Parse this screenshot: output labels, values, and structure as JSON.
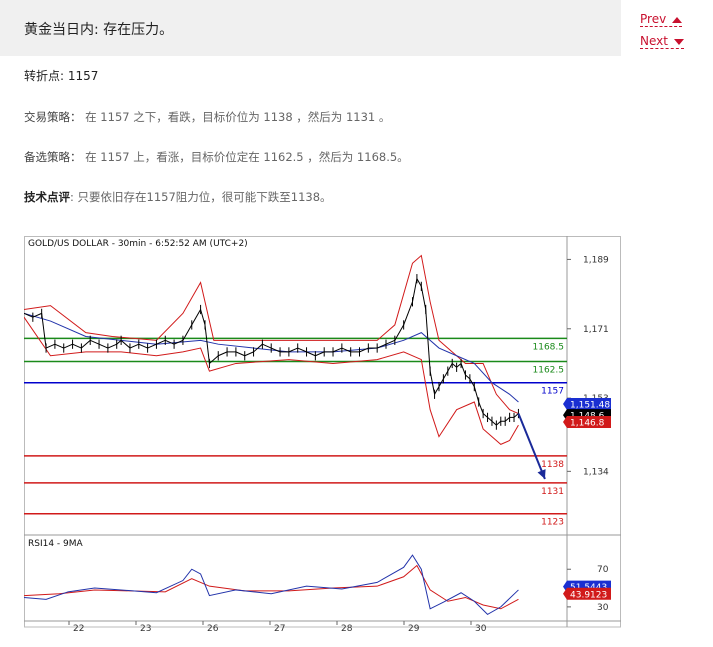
{
  "header": {
    "title": "黄金当日内: 存在压力。"
  },
  "nav": {
    "prev": "Prev",
    "next": "Next"
  },
  "article": {
    "pivot_label": "转折点:",
    "pivot_value": "1157",
    "strategy_label": "交易策略：",
    "strategy_text": "在 1157 之下，看跌，目标价位为 1138 ，然后为 1131 。",
    "alt_label": "备选策略：",
    "alt_text": "在 1157 上，看涨，目标价位定在 1162.5 ，然后为 1168.5。",
    "tech_label": "技术点评",
    "tech_text": ": 只要依旧存在1157阻力位，很可能下跌至1138。"
  },
  "chart": {
    "title": "GOLD/US DOLLAR - 30min - 6:52:52 AM (UTC+2)",
    "rsi_title": "RSI14 - 9MA",
    "colors": {
      "price": "#000000",
      "bollinger": "#d11a1a",
      "ma": "#2233aa",
      "support": "#d11a1a",
      "resistance": "#1a8a1a",
      "pivot": "#0000cc"
    }
  },
  "chart_data": {
    "type": "line",
    "x_ticks": [
      "22",
      "23",
      "26",
      "27",
      "28",
      "29",
      "30"
    ],
    "y_ticks": [
      "1,189",
      "1,171",
      "1,153",
      "1,134"
    ],
    "ylim": [
      1118,
      1193
    ],
    "levels": [
      {
        "label": "1168.5",
        "value": 1168.5,
        "kind": "resistance"
      },
      {
        "label": "1162.5",
        "value": 1162.5,
        "kind": "resistance"
      },
      {
        "label": "1157",
        "value": 1157,
        "kind": "pivot"
      },
      {
        "label": "1138",
        "value": 1138,
        "kind": "support"
      },
      {
        "label": "1131",
        "value": 1131,
        "kind": "support"
      },
      {
        "label": "1123",
        "value": 1123,
        "kind": "support"
      }
    ],
    "price_badges": [
      {
        "label": "1,151.48",
        "value": 1151.48,
        "color": "#1a2fd1"
      },
      {
        "label": "1,148.6",
        "value": 1148.6,
        "color": "#000000"
      },
      {
        "label": "1,146.8",
        "value": 1146.8,
        "color": "#d11a1a"
      }
    ],
    "price": [
      [
        0,
        1175
      ],
      [
        2,
        1174
      ],
      [
        4,
        1175
      ],
      [
        5,
        1166
      ],
      [
        7,
        1167
      ],
      [
        9,
        1166
      ],
      [
        11,
        1167
      ],
      [
        13,
        1166
      ],
      [
        15,
        1168
      ],
      [
        17,
        1167
      ],
      [
        19,
        1166
      ],
      [
        21,
        1167
      ],
      [
        22,
        1168
      ],
      [
        24,
        1166
      ],
      [
        26,
        1167
      ],
      [
        28,
        1166
      ],
      [
        30,
        1167
      ],
      [
        32,
        1168
      ],
      [
        34,
        1167
      ],
      [
        36,
        1168
      ],
      [
        38,
        1172
      ],
      [
        40,
        1176
      ],
      [
        41,
        1172
      ],
      [
        42,
        1162
      ],
      [
        44,
        1164
      ],
      [
        46,
        1165
      ],
      [
        48,
        1165
      ],
      [
        50,
        1164
      ],
      [
        52,
        1165
      ],
      [
        54,
        1167
      ],
      [
        56,
        1166
      ],
      [
        58,
        1165
      ],
      [
        60,
        1165
      ],
      [
        62,
        1166
      ],
      [
        64,
        1165
      ],
      [
        66,
        1164
      ],
      [
        68,
        1165
      ],
      [
        70,
        1165
      ],
      [
        72,
        1166
      ],
      [
        74,
        1165
      ],
      [
        76,
        1165
      ],
      [
        78,
        1166
      ],
      [
        80,
        1166
      ],
      [
        82,
        1167
      ],
      [
        84,
        1168
      ],
      [
        86,
        1172
      ],
      [
        88,
        1178
      ],
      [
        89,
        1184
      ],
      [
        90,
        1182
      ],
      [
        91,
        1176
      ],
      [
        92,
        1160
      ],
      [
        93,
        1154
      ],
      [
        94,
        1156
      ],
      [
        95,
        1158
      ],
      [
        96,
        1160
      ],
      [
        97,
        1162
      ],
      [
        98,
        1161
      ],
      [
        99,
        1162
      ],
      [
        100,
        1159
      ],
      [
        101,
        1158
      ],
      [
        102,
        1156
      ],
      [
        103,
        1152
      ],
      [
        104,
        1149
      ],
      [
        105,
        1148
      ],
      [
        106,
        1147
      ],
      [
        107,
        1146
      ],
      [
        108,
        1147
      ],
      [
        109,
        1147
      ],
      [
        110,
        1148
      ],
      [
        111,
        1148
      ],
      [
        112,
        1149
      ]
    ],
    "ma": [
      [
        0,
        1175
      ],
      [
        6,
        1173
      ],
      [
        14,
        1169
      ],
      [
        22,
        1168
      ],
      [
        30,
        1167
      ],
      [
        40,
        1168
      ],
      [
        44,
        1167
      ],
      [
        52,
        1166
      ],
      [
        60,
        1165
      ],
      [
        70,
        1165
      ],
      [
        80,
        1166
      ],
      [
        86,
        1168
      ],
      [
        90,
        1170
      ],
      [
        94,
        1166
      ],
      [
        98,
        1164
      ],
      [
        102,
        1162
      ],
      [
        106,
        1157
      ],
      [
        110,
        1154
      ],
      [
        112,
        1152
      ]
    ],
    "bb_upper": [
      [
        0,
        1176
      ],
      [
        6,
        1177
      ],
      [
        14,
        1170
      ],
      [
        20,
        1169
      ],
      [
        30,
        1168
      ],
      [
        36,
        1175
      ],
      [
        40,
        1183
      ],
      [
        43,
        1168
      ],
      [
        50,
        1168
      ],
      [
        60,
        1168
      ],
      [
        70,
        1168
      ],
      [
        80,
        1168
      ],
      [
        84,
        1172
      ],
      [
        88,
        1188
      ],
      [
        90,
        1190
      ],
      [
        92,
        1178
      ],
      [
        94,
        1168
      ],
      [
        100,
        1162
      ],
      [
        104,
        1162
      ],
      [
        107,
        1154
      ],
      [
        110,
        1150
      ],
      [
        112,
        1149
      ]
    ],
    "bb_lower": [
      [
        0,
        1174
      ],
      [
        6,
        1164
      ],
      [
        14,
        1165
      ],
      [
        22,
        1165
      ],
      [
        30,
        1164
      ],
      [
        36,
        1165
      ],
      [
        40,
        1166
      ],
      [
        42,
        1160
      ],
      [
        48,
        1162
      ],
      [
        60,
        1163
      ],
      [
        70,
        1162
      ],
      [
        80,
        1163
      ],
      [
        86,
        1165
      ],
      [
        90,
        1163
      ],
      [
        92,
        1150
      ],
      [
        94,
        1143
      ],
      [
        98,
        1150
      ],
      [
        102,
        1152
      ],
      [
        104,
        1145
      ],
      [
        108,
        1141
      ],
      [
        110,
        1142
      ],
      [
        112,
        1146
      ]
    ],
    "forecast": [
      [
        112,
        1149
      ],
      [
        118,
        1132
      ]
    ],
    "rsi": {
      "ylim": [
        15,
        100
      ],
      "y_ticks": [
        "70",
        "30"
      ],
      "values": [
        [
          0,
          40
        ],
        [
          5,
          38
        ],
        [
          10,
          46
        ],
        [
          16,
          50
        ],
        [
          22,
          48
        ],
        [
          30,
          45
        ],
        [
          36,
          58
        ],
        [
          38,
          70
        ],
        [
          40,
          65
        ],
        [
          42,
          42
        ],
        [
          48,
          48
        ],
        [
          56,
          44
        ],
        [
          64,
          52
        ],
        [
          72,
          49
        ],
        [
          80,
          56
        ],
        [
          86,
          72
        ],
        [
          88,
          85
        ],
        [
          90,
          70
        ],
        [
          92,
          28
        ],
        [
          95,
          35
        ],
        [
          99,
          45
        ],
        [
          102,
          36
        ],
        [
          105,
          22
        ],
        [
          108,
          30
        ],
        [
          112,
          48
        ]
      ],
      "ma_values": [
        [
          0,
          42
        ],
        [
          8,
          44
        ],
        [
          16,
          48
        ],
        [
          24,
          47
        ],
        [
          32,
          46
        ],
        [
          38,
          60
        ],
        [
          42,
          52
        ],
        [
          50,
          47
        ],
        [
          60,
          47
        ],
        [
          70,
          50
        ],
        [
          80,
          52
        ],
        [
          86,
          62
        ],
        [
          89,
          74
        ],
        [
          92,
          48
        ],
        [
          96,
          36
        ],
        [
          100,
          40
        ],
        [
          104,
          32
        ],
        [
          108,
          28
        ],
        [
          112,
          38
        ]
      ],
      "badges": [
        {
          "label": "51.5443",
          "value": 51.5443,
          "color": "#1a2fd1"
        },
        {
          "label": "43.9123",
          "value": 43.9123,
          "color": "#d11a1a"
        }
      ]
    }
  }
}
